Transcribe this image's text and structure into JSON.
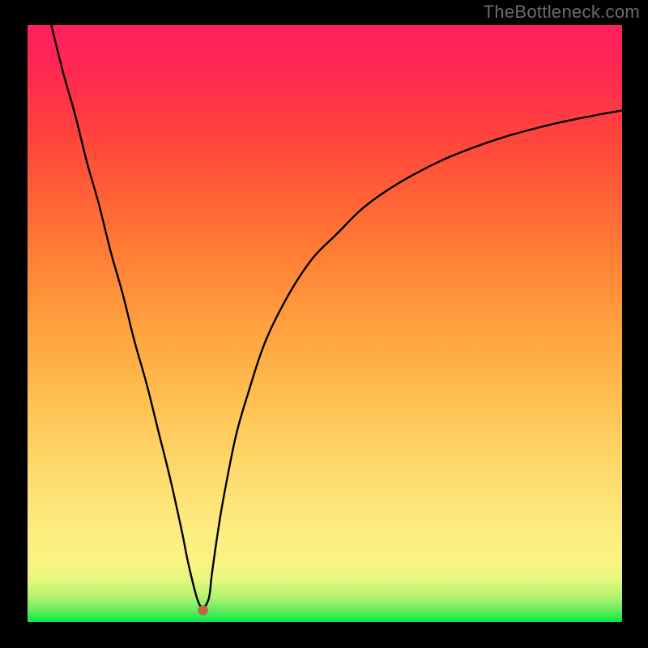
{
  "watermark": "TheBottleneck.com",
  "colors": {
    "background": "#000000",
    "curve": "#000000",
    "dot": "#c9614f"
  },
  "chart_data": {
    "type": "line",
    "title": "",
    "xlabel": "",
    "ylabel": "",
    "xlim": [
      0,
      100
    ],
    "ylim": [
      0,
      100
    ],
    "legend": false,
    "grid": false,
    "background": "rainbow-gradient-green-to-red",
    "minimum_point": {
      "x": 29.5,
      "y": 2
    },
    "series": [
      {
        "name": "left-branch",
        "x": [
          4,
          6,
          8,
          10,
          12,
          14,
          16,
          18,
          20,
          22,
          24,
          26,
          27,
          28.5,
          29.5
        ],
        "y": [
          100,
          92,
          85,
          77,
          70,
          62,
          55,
          47,
          40,
          32,
          24,
          15,
          10,
          4,
          2
        ]
      },
      {
        "name": "right-branch",
        "x": [
          29.5,
          30.5,
          31,
          32,
          33,
          35,
          37,
          40,
          44,
          48,
          52,
          56,
          60,
          65,
          70,
          75,
          80,
          85,
          90,
          95,
          100
        ],
        "y": [
          2,
          4,
          8,
          15,
          21,
          31,
          38,
          47,
          55,
          61,
          65,
          69,
          72,
          75,
          77.5,
          79.5,
          81.2,
          82.6,
          83.8,
          84.8,
          85.7
        ]
      }
    ]
  }
}
